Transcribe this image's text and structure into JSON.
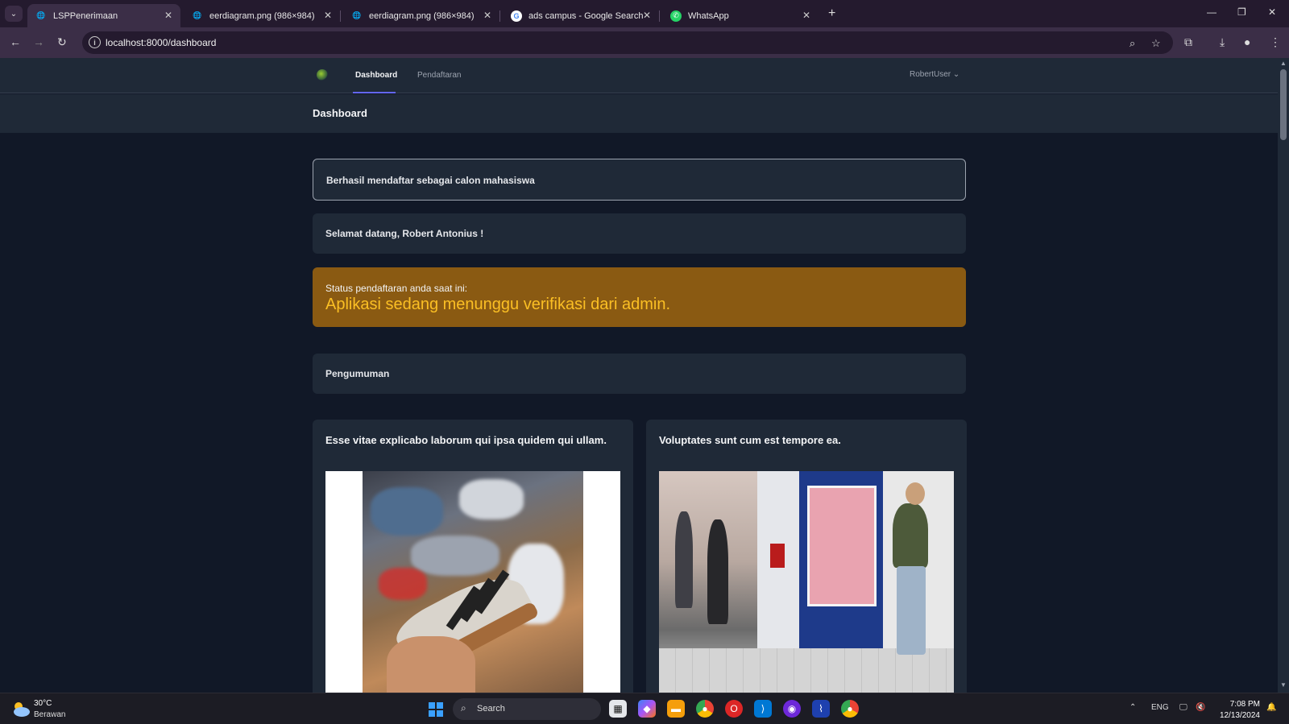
{
  "browser": {
    "tabs": [
      {
        "title": "LSPPenerimaan",
        "active": true
      },
      {
        "title": "eerdiagram.png (986×984)",
        "active": false
      },
      {
        "title": "eerdiagram.png (986×984)",
        "active": false
      },
      {
        "title": "ads campus - Google Search",
        "active": false
      },
      {
        "title": "WhatsApp",
        "active": false
      }
    ],
    "url": "localhost:8000/dashboard"
  },
  "nav": {
    "links": [
      "Dashboard",
      "Pendaftaran"
    ],
    "active": "Dashboard",
    "user": "RobertUser"
  },
  "header": {
    "title": "Dashboard"
  },
  "alerts": {
    "success": "Berhasil mendaftar sebagai calon mahasiswa",
    "welcome": "Selamat datang, Robert Antonius !",
    "status_label": "Status pendaftaran anda saat ini:",
    "status_message": "Aplikasi sedang menunggu verifikasi dari admin."
  },
  "announcements": {
    "heading": "Pengumuman",
    "posts": [
      {
        "title": "Esse vitae explicabo laborum qui ipsa quidem qui ullam."
      },
      {
        "title": "Voluptates sunt cum est tempore ea."
      }
    ]
  },
  "taskbar": {
    "weather_temp": "30°C",
    "weather_desc": "Berawan",
    "search_label": "Search",
    "language": "ENG",
    "time": "7:08 PM",
    "date": "12/13/2024"
  },
  "colors": {
    "page_bg": "#111827",
    "card_bg": "#1f2937",
    "status_bg": "#8a5a12",
    "status_text": "#fbbf24",
    "accent": "#6366f1"
  }
}
